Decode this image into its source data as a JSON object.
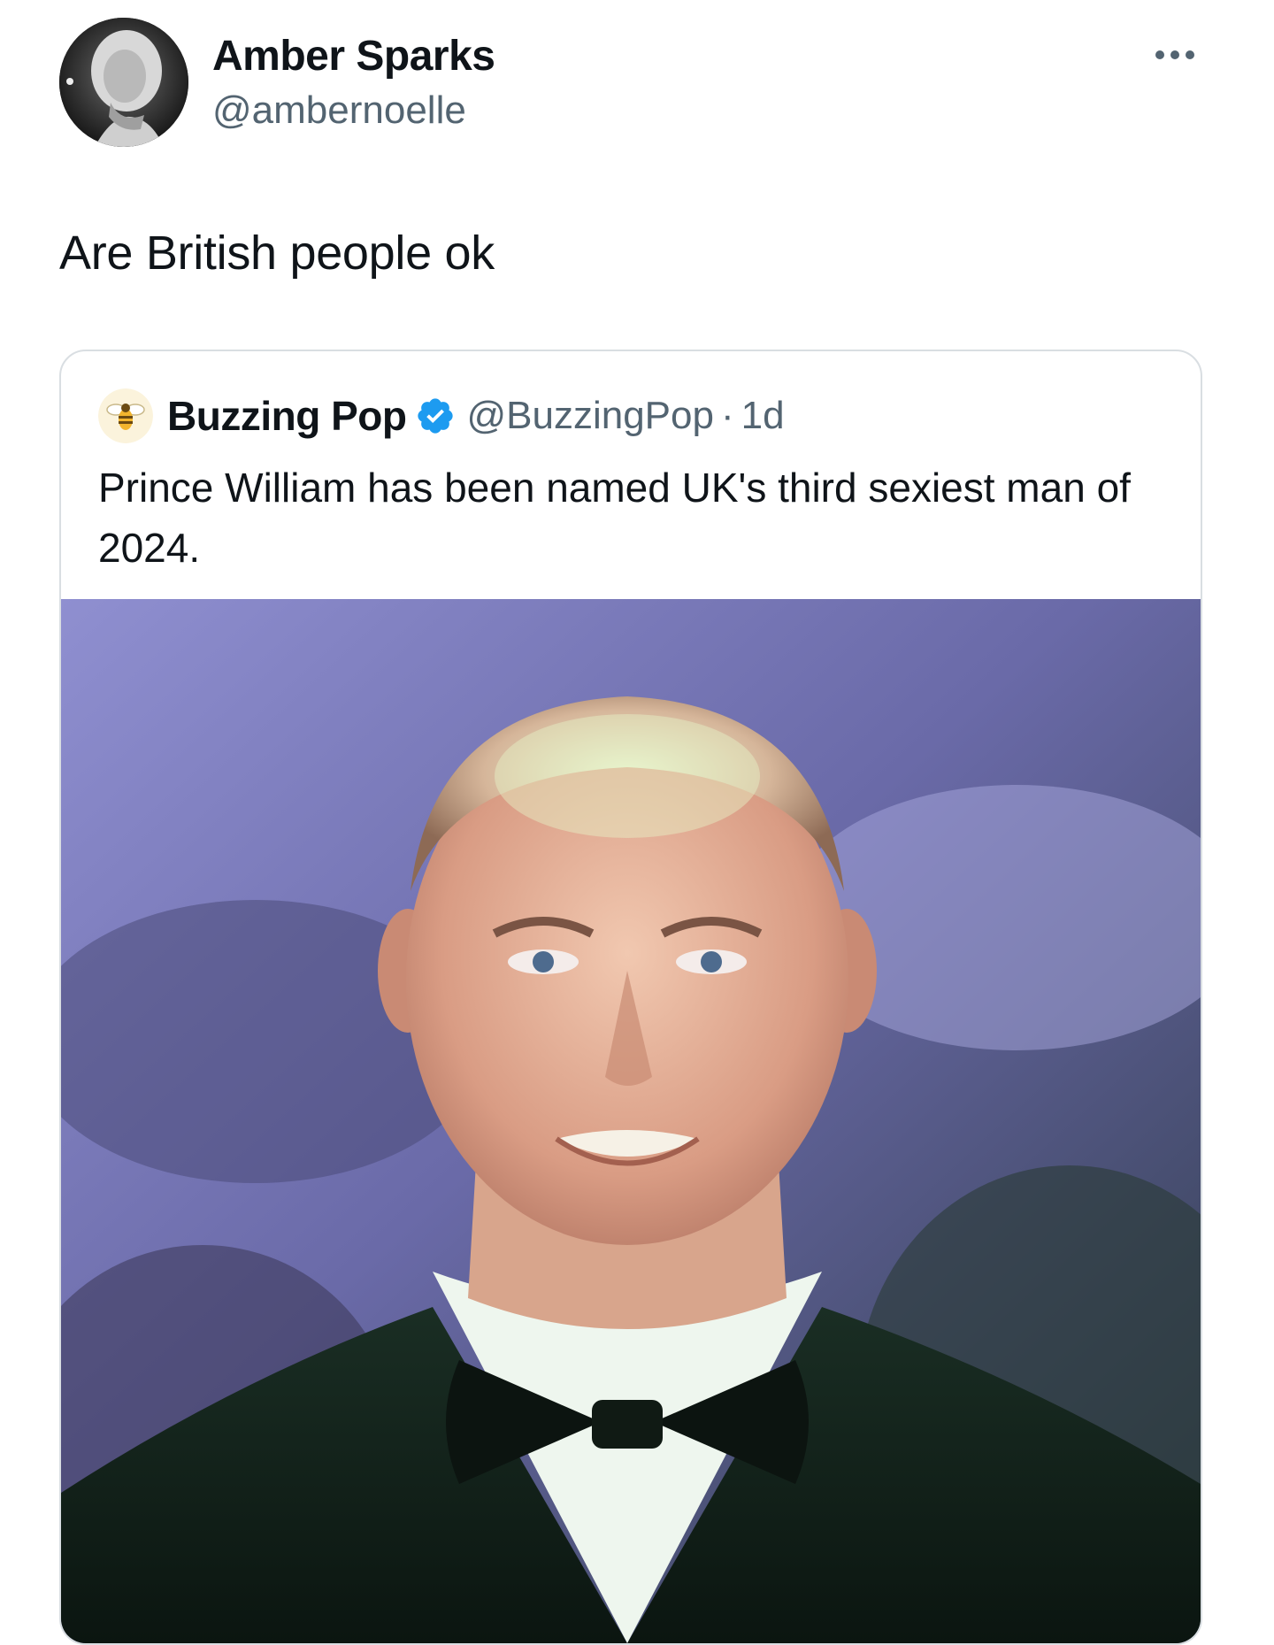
{
  "tweet": {
    "author_name": "Amber Sparks",
    "author_handle": "@ambernoelle",
    "text": "Are British people ok",
    "more_icon": "more-horizontal-icon"
  },
  "quoted_tweet": {
    "author_name": "Buzzing Pop",
    "verified": true,
    "verified_icon": "verified-badge-icon",
    "author_handle": "@BuzzingPop",
    "separator": "·",
    "time": "1d",
    "text": "Prince William has been named UK's third sexiest man of 2024."
  },
  "colors": {
    "text_primary": "#0f1419",
    "text_secondary": "#536471",
    "border": "#d9dee2",
    "verified_blue": "#1d9bf0"
  }
}
